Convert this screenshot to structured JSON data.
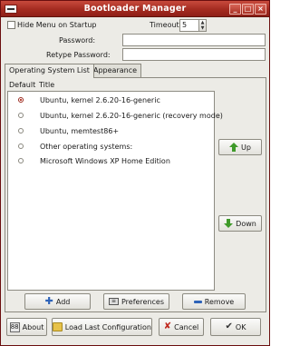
{
  "window": {
    "title": "Bootloader Manager"
  },
  "options": {
    "hide_menu_label": "Hide Menu on Startup",
    "timeout_label": "Timeout",
    "timeout_value": "5",
    "password_label": "Password:",
    "retype_password_label": "Retype Password:"
  },
  "tabs": [
    {
      "label": "Operating System List"
    },
    {
      "label": "Appearance"
    }
  ],
  "list": {
    "headers": {
      "default": "Default",
      "title": "Title"
    },
    "items": [
      {
        "title": "Ubuntu, kernel 2.6.20-16-generic",
        "default": true
      },
      {
        "title": "Ubuntu, kernel 2.6.20-16-generic (recovery mode)",
        "default": false
      },
      {
        "title": "Ubuntu, memtest86+",
        "default": false
      },
      {
        "title": "Other operating systems:",
        "default": false
      },
      {
        "title": "Microsoft Windows XP Home Edition",
        "default": false
      }
    ]
  },
  "side_buttons": {
    "up": "Up",
    "down": "Down"
  },
  "list_buttons": {
    "add": "Add",
    "preferences": "Preferences",
    "remove": "Remove"
  },
  "footer": {
    "about": "About",
    "load": "Load Last Configuration",
    "cancel": "Cancel",
    "ok": "OK"
  },
  "colors": {
    "titlebar": "#a42b20",
    "accent_green": "#3f9a2a",
    "accent_blue": "#2e63b8"
  }
}
